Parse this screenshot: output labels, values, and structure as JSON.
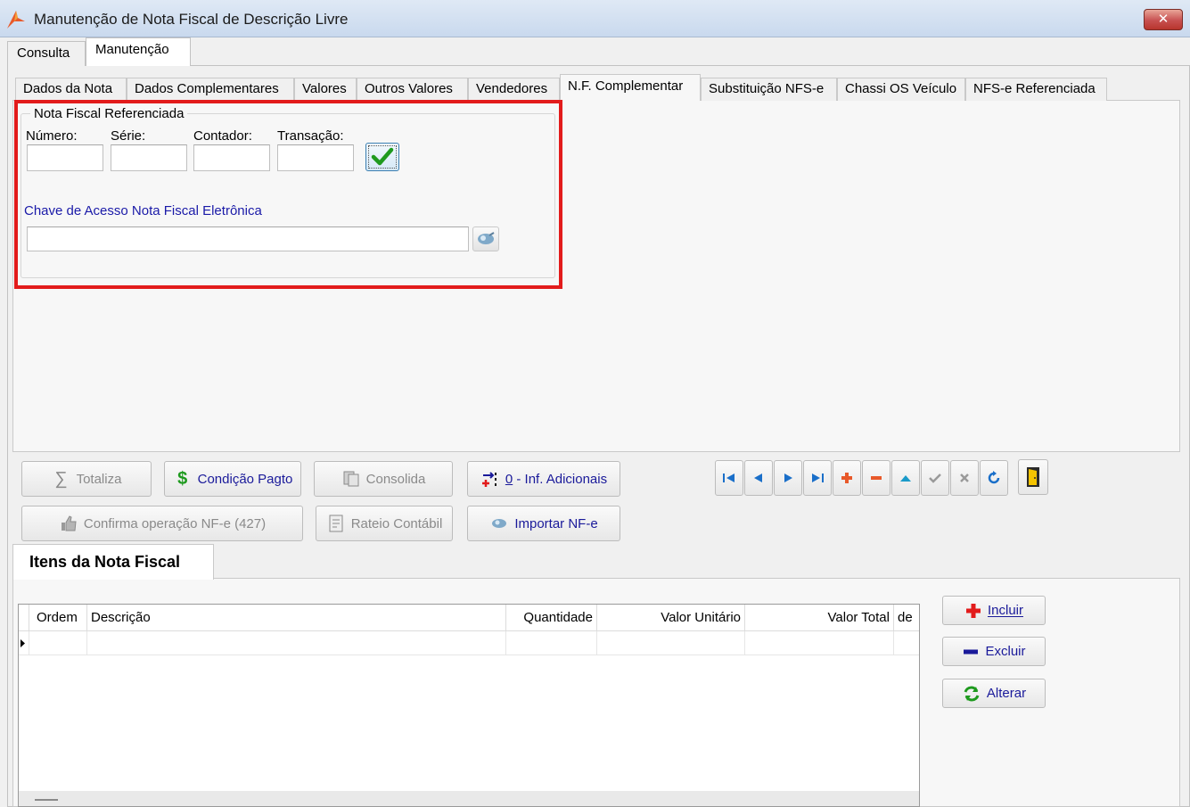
{
  "window": {
    "title": "Manutenção de Nota Fiscal de Descrição Livre",
    "close_label": "✕"
  },
  "top_tabs": [
    {
      "label": "Consulta",
      "active": false
    },
    {
      "label": "Manutenção",
      "active": true
    }
  ],
  "inner_tabs": [
    {
      "label": "Dados da Nota"
    },
    {
      "label": "Dados Complementares"
    },
    {
      "label": "Valores"
    },
    {
      "label": "Outros Valores"
    },
    {
      "label": "Vendedores"
    },
    {
      "label": "N.F. Complementar",
      "active": true
    },
    {
      "label": "Substituição NFS-e"
    },
    {
      "label": "Chassi OS Veículo"
    },
    {
      "label": "NFS-e Referenciada"
    }
  ],
  "nf_referenciada": {
    "legend": "Nota Fiscal Referenciada",
    "numero_label": "Número:",
    "serie_label": "Série:",
    "contador_label": "Contador:",
    "transacao_label": "Transação:",
    "numero_value": "",
    "serie_value": "",
    "contador_value": "",
    "transacao_value": "",
    "chave_label": "Chave de Acesso Nota Fiscal Eletrônica",
    "chave_value": ""
  },
  "actions": {
    "totaliza": "Totaliza",
    "condicao_pagto": "Condição Pagto",
    "consolida": "Consolida",
    "inf_adicionais_prefix": "0",
    "inf_adicionais_rest": " - Inf. Adicionais",
    "confirma": "Confirma operação NF-e (427)",
    "rateio": "Rateio Contábil",
    "importar": "Importar NF-e"
  },
  "items": {
    "tab_label": "Itens da Nota Fiscal",
    "columns": [
      "Ordem",
      "Descrição",
      "Quantidade",
      "Valor Unitário",
      "Valor Total",
      "de"
    ],
    "rows": [],
    "incluir": "Incluir",
    "excluir": "Excluir",
    "alterar": "Alterar"
  },
  "colors": {
    "highlight_frame": "#e21b1b",
    "link_blue": "#1a1aa8",
    "check_green": "#1e9a1e"
  }
}
